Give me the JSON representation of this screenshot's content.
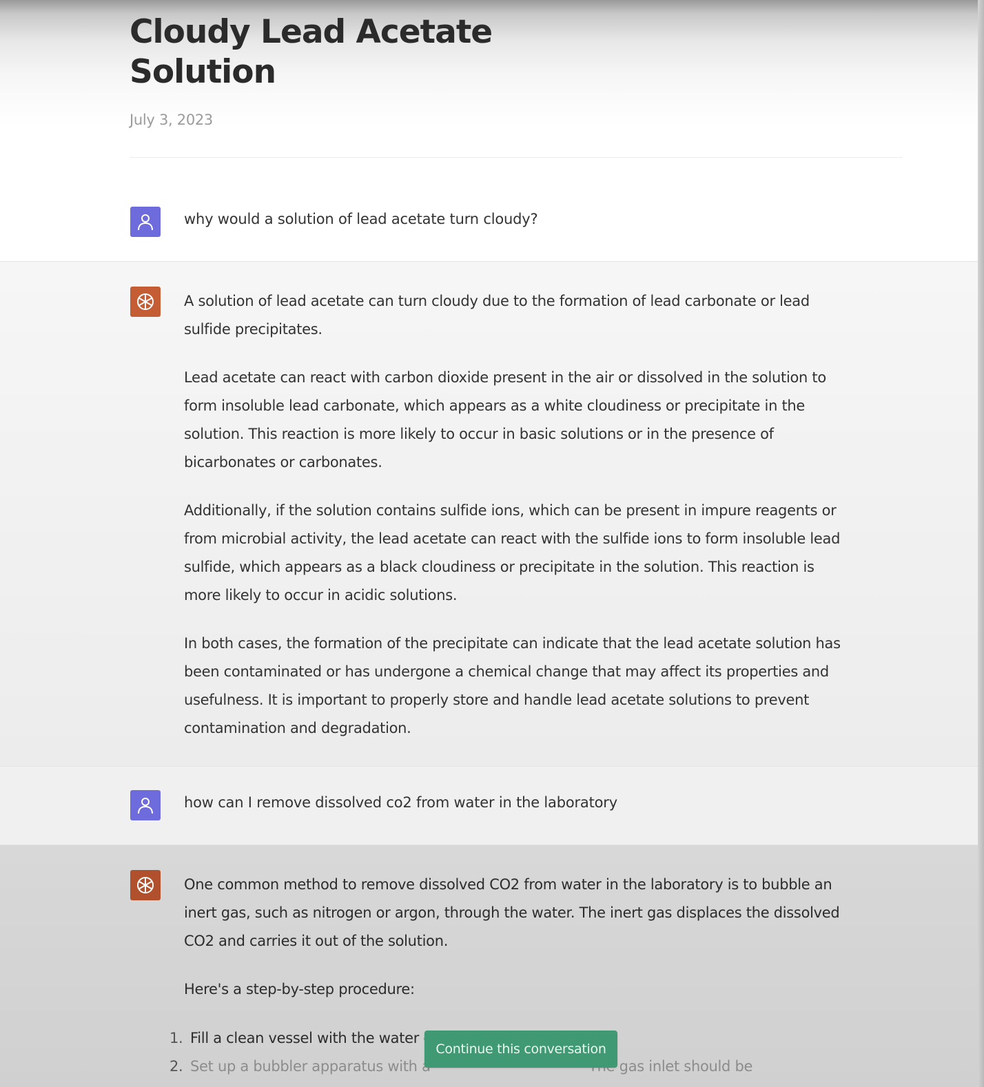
{
  "header": {
    "title": "Cloudy Lead Acetate Solution",
    "date": "July 3, 2023"
  },
  "conversation": [
    {
      "role": "user",
      "avatar_icon": "user-icon",
      "text": "why would a solution of lead acetate turn cloudy?"
    },
    {
      "role": "assistant",
      "avatar_icon": "openai-logo-icon",
      "paragraphs": [
        "A solution of lead acetate can turn cloudy due to the formation of lead carbonate or lead sulfide precipitates.",
        "Lead acetate can react with carbon dioxide present in the air or dissolved in the solution to form insoluble lead carbonate, which appears as a white cloudiness or precipitate in the solution. This reaction is more likely to occur in basic solutions or in the presence of bicarbonates or carbonates.",
        "Additionally, if the solution contains sulfide ions, which can be present in impure reagents or from microbial activity, the lead acetate can react with the sulfide ions to form insoluble lead sulfide, which appears as a black cloudiness or precipitate in the solution. This reaction is more likely to occur in acidic solutions.",
        "In both cases, the formation of the precipitate can indicate that the lead acetate solution has been contaminated or has undergone a chemical change that may affect its properties and usefulness. It is important to properly store and handle lead acetate solutions to prevent contamination and degradation."
      ]
    },
    {
      "role": "user",
      "avatar_icon": "user-icon",
      "text": "how can I remove dissolved co2 from water in the laboratory"
    },
    {
      "role": "assistant",
      "avatar_icon": "openai-logo-icon",
      "paragraphs": [
        "One common method to remove dissolved CO2 from water in the laboratory is to bubble an inert gas, such as nitrogen or argon, through the water. The inert gas displaces the dissolved CO2 and carries it out of the solution.",
        "Here's a step-by-step procedure:"
      ],
      "steps": [
        {
          "num": "1.",
          "text": "Fill a clean vessel with the water c"
        },
        {
          "num": "2.",
          "text": "Set up a bubbler apparatus with a                                    The gas inlet should be"
        }
      ]
    }
  ],
  "continue_button": {
    "label": "Continue this conversation"
  },
  "colors": {
    "user_avatar": "#6e6bdc",
    "assistant_avatar": "#c45c34",
    "continue_button": "#3f9a74"
  }
}
